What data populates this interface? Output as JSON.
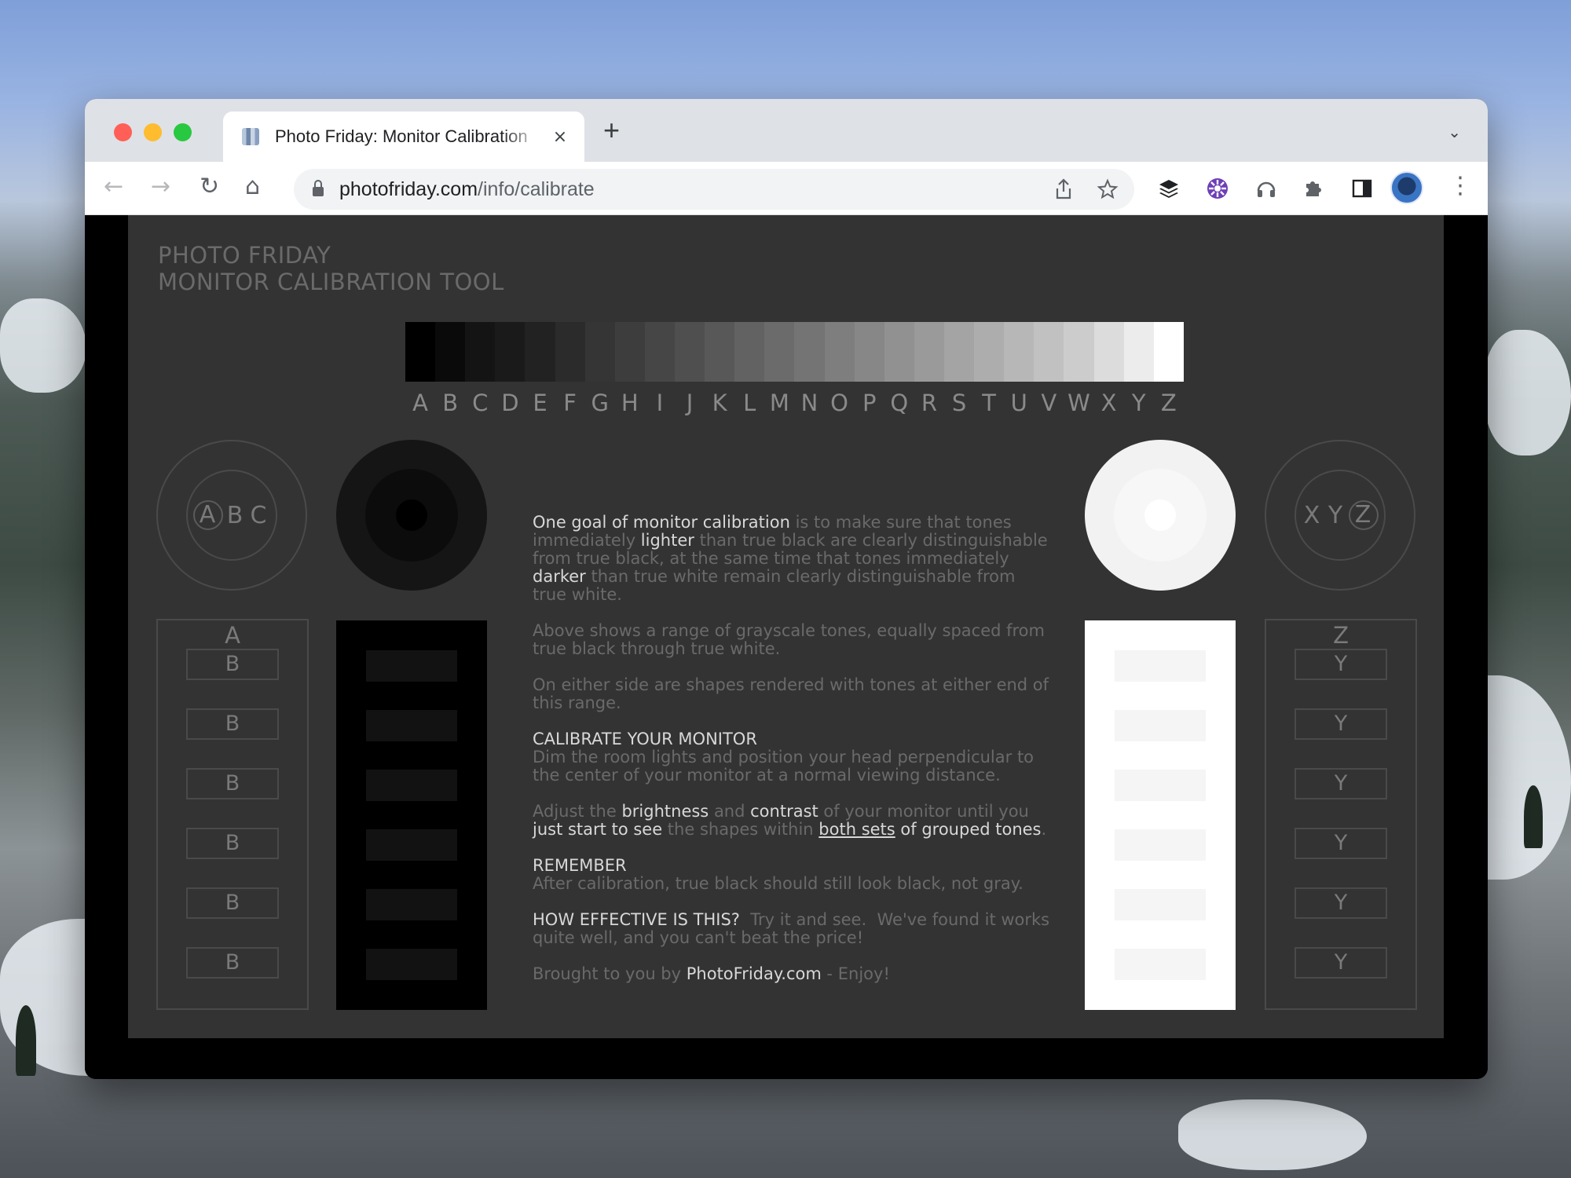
{
  "browser": {
    "tab_title": "Photo Friday: Monitor Calibration",
    "tab_close": "×",
    "new_tab": "+",
    "tab_menu": "⌄",
    "url_domain": "photofriday.com",
    "url_path": "/info/calibrate",
    "nav": {
      "back": "←",
      "forward": "→",
      "reload": "↻",
      "home": "⌂"
    },
    "icons": [
      "share-icon",
      "star-icon",
      "buffer-extension-icon",
      "flower-extension-icon",
      "headphones-extension-icon",
      "puzzle-extensions-icon",
      "side-panel-icon",
      "profile-avatar",
      "kebab-menu-icon"
    ]
  },
  "page": {
    "heading_line1": "PHOTO FRIDAY",
    "heading_line2": "MONITOR CALIBRATION TOOL",
    "grayscale": {
      "letters": [
        "A",
        "B",
        "C",
        "D",
        "E",
        "F",
        "G",
        "H",
        "I",
        "J",
        "K",
        "L",
        "M",
        "N",
        "O",
        "P",
        "Q",
        "R",
        "S",
        "T",
        "U",
        "V",
        "W",
        "X",
        "Y",
        "Z"
      ],
      "colors": [
        "#000000",
        "#0a0a0a",
        "#141414",
        "#1a1a1a",
        "#222222",
        "#2b2b2b",
        "#353535",
        "#3d3d3d",
        "#464646",
        "#4f4f4f",
        "#585858",
        "#626262",
        "#6b6b6b",
        "#747474",
        "#7e7e7e",
        "#878787",
        "#919191",
        "#9a9a9a",
        "#a4a4a4",
        "#adadad",
        "#b7b7b7",
        "#c1c1c1",
        "#cccccc",
        "#dcdcdc",
        "#ececec",
        "#ffffff"
      ]
    },
    "left_ring": {
      "circled_a": "A",
      "b": "B",
      "c": "C"
    },
    "right_ring": {
      "x": "X",
      "y": "Y",
      "circled_z": "Z"
    },
    "left_box": {
      "head": "A",
      "items": [
        "B",
        "B",
        "B",
        "B",
        "B",
        "B"
      ]
    },
    "right_box": {
      "head": "Z",
      "items": [
        "Y",
        "Y",
        "Y",
        "Y",
        "Y",
        "Y"
      ]
    },
    "colors": {
      "dark_target": [
        "#151515",
        "#0c0c0c",
        "#000000"
      ],
      "light_target": [
        "#f2f2f2",
        "#f7f7f7",
        "#ffffff"
      ],
      "dark_box_bg": "#000000",
      "dark_box_rect": "#121212",
      "light_box_bg": "#ffffff",
      "light_box_rect": "#f5f5f5"
    },
    "article": {
      "p1_a": "One goal of monitor calibration",
      "p1_b": " is to make sure that tones immediately ",
      "p1_c": "lighter",
      "p1_d": " than true black are clearly distinguishable from true black, at the same time that tones immediately ",
      "p1_e": "darker",
      "p1_f": " than true white remain clearly distinguishable from true white.",
      "p2": "Above shows a range of grayscale tones, equally spaced from true black through true white.",
      "p3": "On either side are shapes rendered with tones at either end of this range.",
      "p4_head": "CALIBRATE YOUR MONITOR",
      "p4_body": "Dim the room lights and position your head perpendicular to the center of your monitor at a normal viewing distance.",
      "p5_a": "Adjust the ",
      "p5_b": "brightness",
      "p5_c": " and ",
      "p5_d": "contrast",
      "p5_e": " of your monitor until you ",
      "p5_f": "just start to see",
      "p5_g": " the shapes within ",
      "p5_h": "both sets",
      "p5_i": " of ",
      "p5_j": "grouped tones",
      "p5_k": ".",
      "p6_head": "REMEMBER",
      "p6_body": "After calibration, true black should still look black, not gray.",
      "p7_head": "HOW EFFECTIVE IS THIS?",
      "p7_body": "  Try it and see.  We've found it works quite well, and you can't beat the price!",
      "p8_a": "Brought to you by ",
      "p8_b": "PhotoFriday.com",
      "p8_c": " - Enjoy!"
    }
  }
}
